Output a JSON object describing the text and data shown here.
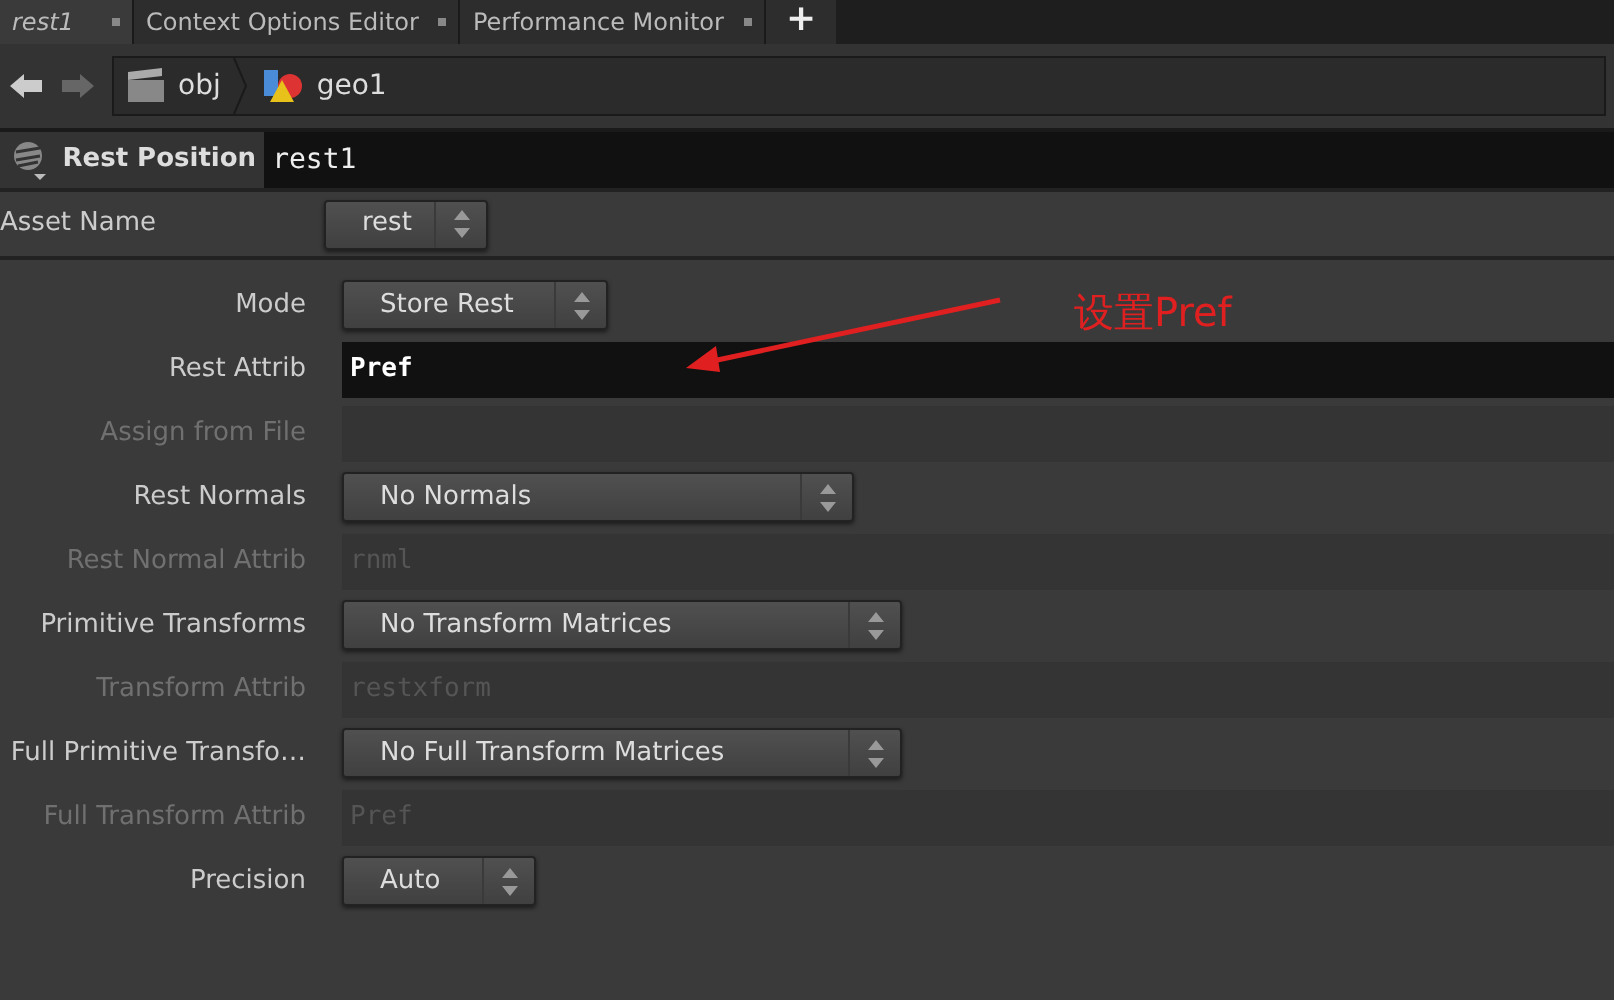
{
  "tabs": [
    {
      "label": "rest1",
      "selected": true
    },
    {
      "label": "Context Options Editor",
      "selected": false
    },
    {
      "label": "Performance Monitor",
      "selected": false
    }
  ],
  "add_tab": "+",
  "path": [
    "obj",
    "geo1"
  ],
  "node": {
    "type": "Rest Position",
    "name": "rest1"
  },
  "asset": {
    "label": "Asset Name",
    "value": "rest"
  },
  "parameters": [
    {
      "label": "Mode",
      "kind": "menu",
      "value": "Store Rest",
      "disabled": false
    },
    {
      "label": "Rest Attrib",
      "kind": "text",
      "value": "Pref",
      "disabled": false
    },
    {
      "label": "Assign from File",
      "kind": "text",
      "disabled": true
    },
    {
      "label": "Rest Normals",
      "kind": "menu",
      "value": "No Normals",
      "disabled": false
    },
    {
      "label": "Rest Normal Attrib",
      "kind": "text",
      "value": "rnml",
      "disabled": true
    },
    {
      "label": "Primitive Transforms",
      "kind": "menu",
      "value": "No Transform Matrices",
      "disabled": false
    },
    {
      "label": "Transform Attrib",
      "kind": "text",
      "value": "restxform",
      "disabled": true
    },
    {
      "label": "Full Primitive Transfo…",
      "kind": "menu",
      "value": "No Full Transform Matrices",
      "disabled": false
    },
    {
      "label": "Full Transform Attrib",
      "kind": "text",
      "value": "Pref",
      "disabled": true
    },
    {
      "label": "Precision",
      "kind": "menu",
      "value": "Auto",
      "disabled": false
    }
  ],
  "annotation": {
    "text": "设置Pref"
  }
}
